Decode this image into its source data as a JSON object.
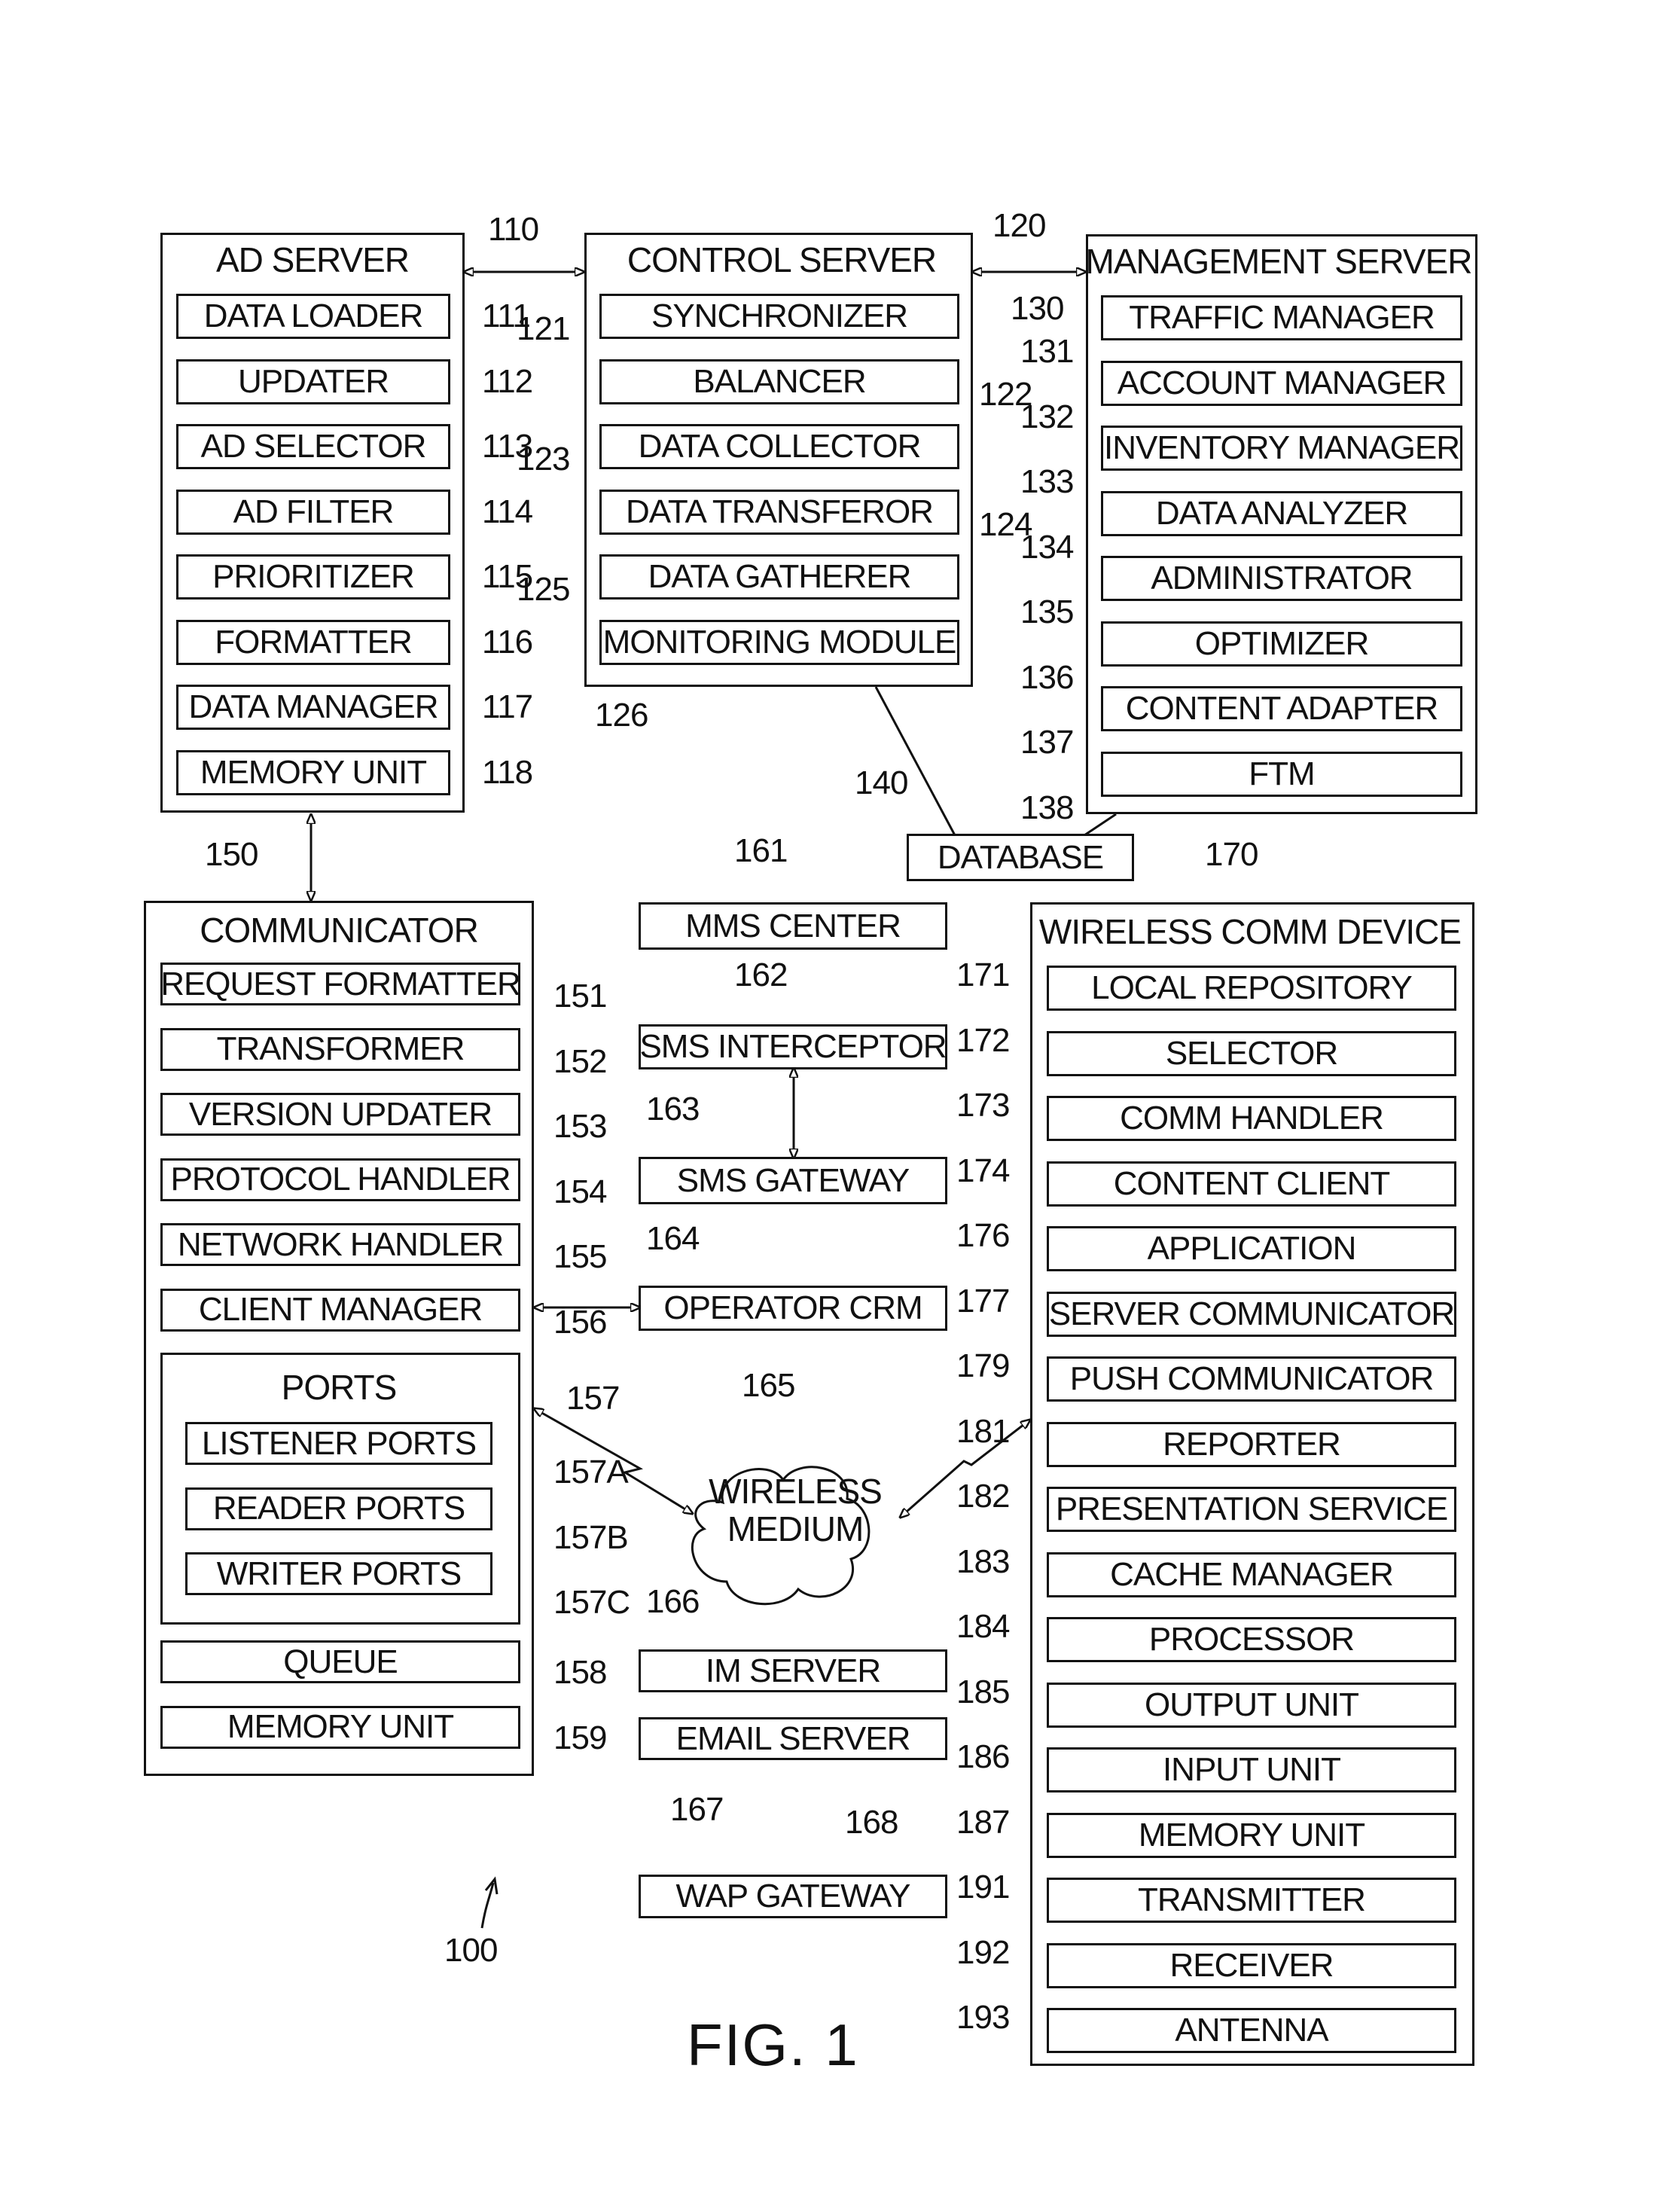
{
  "figure_label": "FIG. 1",
  "system_ref": "100",
  "ad_server": {
    "ref": "110",
    "title": "AD SERVER",
    "items": [
      {
        "label": "DATA LOADER",
        "ref": "111"
      },
      {
        "label": "UPDATER",
        "ref": "112"
      },
      {
        "label": "AD SELECTOR",
        "ref": "113"
      },
      {
        "label": "AD FILTER",
        "ref": "114"
      },
      {
        "label": "PRIORITIZER",
        "ref": "115"
      },
      {
        "label": "FORMATTER",
        "ref": "116"
      },
      {
        "label": "DATA MANAGER",
        "ref": "117"
      },
      {
        "label": "MEMORY UNIT",
        "ref": "118"
      }
    ]
  },
  "control_server": {
    "ref": "120",
    "title": "CONTROL SERVER",
    "items": [
      {
        "label": "SYNCHRONIZER",
        "ref": "121"
      },
      {
        "label": "BALANCER",
        "ref": "122"
      },
      {
        "label": "DATA COLLECTOR",
        "ref": "123"
      },
      {
        "label": "DATA TRANSFEROR",
        "ref": "124"
      },
      {
        "label": "DATA GATHERER",
        "ref": "125"
      },
      {
        "label": "MONITORING MODULE",
        "ref": "126"
      }
    ]
  },
  "management_server": {
    "ref": "130",
    "title": "MANAGEMENT SERVER",
    "items": [
      {
        "label": "TRAFFIC MANAGER",
        "ref": "131"
      },
      {
        "label": "ACCOUNT MANAGER",
        "ref": "132"
      },
      {
        "label": "INVENTORY MANAGER",
        "ref": "133"
      },
      {
        "label": "DATA ANALYZER",
        "ref": "134"
      },
      {
        "label": "ADMINISTRATOR",
        "ref": "135"
      },
      {
        "label": "OPTIMIZER",
        "ref": "136"
      },
      {
        "label": "CONTENT ADAPTER",
        "ref": "137"
      },
      {
        "label": "FTM",
        "ref": "138"
      }
    ]
  },
  "database": {
    "label": "DATABASE",
    "ref": "140"
  },
  "communicator": {
    "ref": "150",
    "title": "COMMUNICATOR",
    "items": [
      {
        "label": "REQUEST FORMATTER",
        "ref": "151"
      },
      {
        "label": "TRANSFORMER",
        "ref": "152"
      },
      {
        "label": "VERSION UPDATER",
        "ref": "153"
      },
      {
        "label": "PROTOCOL HANDLER",
        "ref": "154"
      },
      {
        "label": "NETWORK HANDLER",
        "ref": "155"
      },
      {
        "label": "CLIENT MANAGER",
        "ref": "156"
      }
    ],
    "ports": {
      "title": "PORTS",
      "ref": "157",
      "items": [
        {
          "label": "LISTENER PORTS",
          "ref": "157A"
        },
        {
          "label": "READER PORTS",
          "ref": "157B"
        },
        {
          "label": "WRITER PORTS",
          "ref": "157C"
        }
      ]
    },
    "bottom_items": [
      {
        "label": "QUEUE",
        "ref": "158"
      },
      {
        "label": "MEMORY UNIT",
        "ref": "159"
      }
    ]
  },
  "middle": {
    "mms_center": {
      "label": "MMS CENTER",
      "ref": "161"
    },
    "sms_interceptor": {
      "label": "SMS INTERCEPTOR",
      "ref": "162"
    },
    "sms_gateway": {
      "label": "SMS GATEWAY",
      "ref": "163"
    },
    "operator_crm": {
      "label": "OPERATOR CRM",
      "ref": "164"
    },
    "wireless_medium": {
      "line1": "WIRELESS",
      "line2": "MEDIUM",
      "ref": "165"
    },
    "im_server": {
      "label": "IM SERVER",
      "ref": "166"
    },
    "email_server": {
      "label": "EMAIL SERVER",
      "ref": "167"
    },
    "wap_gateway": {
      "label": "WAP GATEWAY",
      "ref": "168"
    }
  },
  "wireless_device": {
    "ref": "170",
    "title": "WIRELESS COMM DEVICE",
    "items": [
      {
        "label": "LOCAL REPOSITORY",
        "ref": "171"
      },
      {
        "label": "SELECTOR",
        "ref": "172"
      },
      {
        "label": "COMM HANDLER",
        "ref": "173"
      },
      {
        "label": "CONTENT CLIENT",
        "ref": "174"
      },
      {
        "label": "APPLICATION",
        "ref": "176"
      },
      {
        "label": "SERVER COMMUNICATOR",
        "ref": "177"
      },
      {
        "label": "PUSH COMMUNICATOR",
        "ref": "179"
      },
      {
        "label": "REPORTER",
        "ref": "181"
      },
      {
        "label": "PRESENTATION SERVICE",
        "ref": "182"
      },
      {
        "label": "CACHE MANAGER",
        "ref": "183"
      },
      {
        "label": "PROCESSOR",
        "ref": "184"
      },
      {
        "label": "OUTPUT UNIT",
        "ref": "185"
      },
      {
        "label": "INPUT UNIT",
        "ref": "186"
      },
      {
        "label": "MEMORY UNIT",
        "ref": "187"
      },
      {
        "label": "TRANSMITTER",
        "ref": "191"
      },
      {
        "label": "RECEIVER",
        "ref": "192"
      },
      {
        "label": "ANTENNA",
        "ref": "193"
      }
    ]
  }
}
